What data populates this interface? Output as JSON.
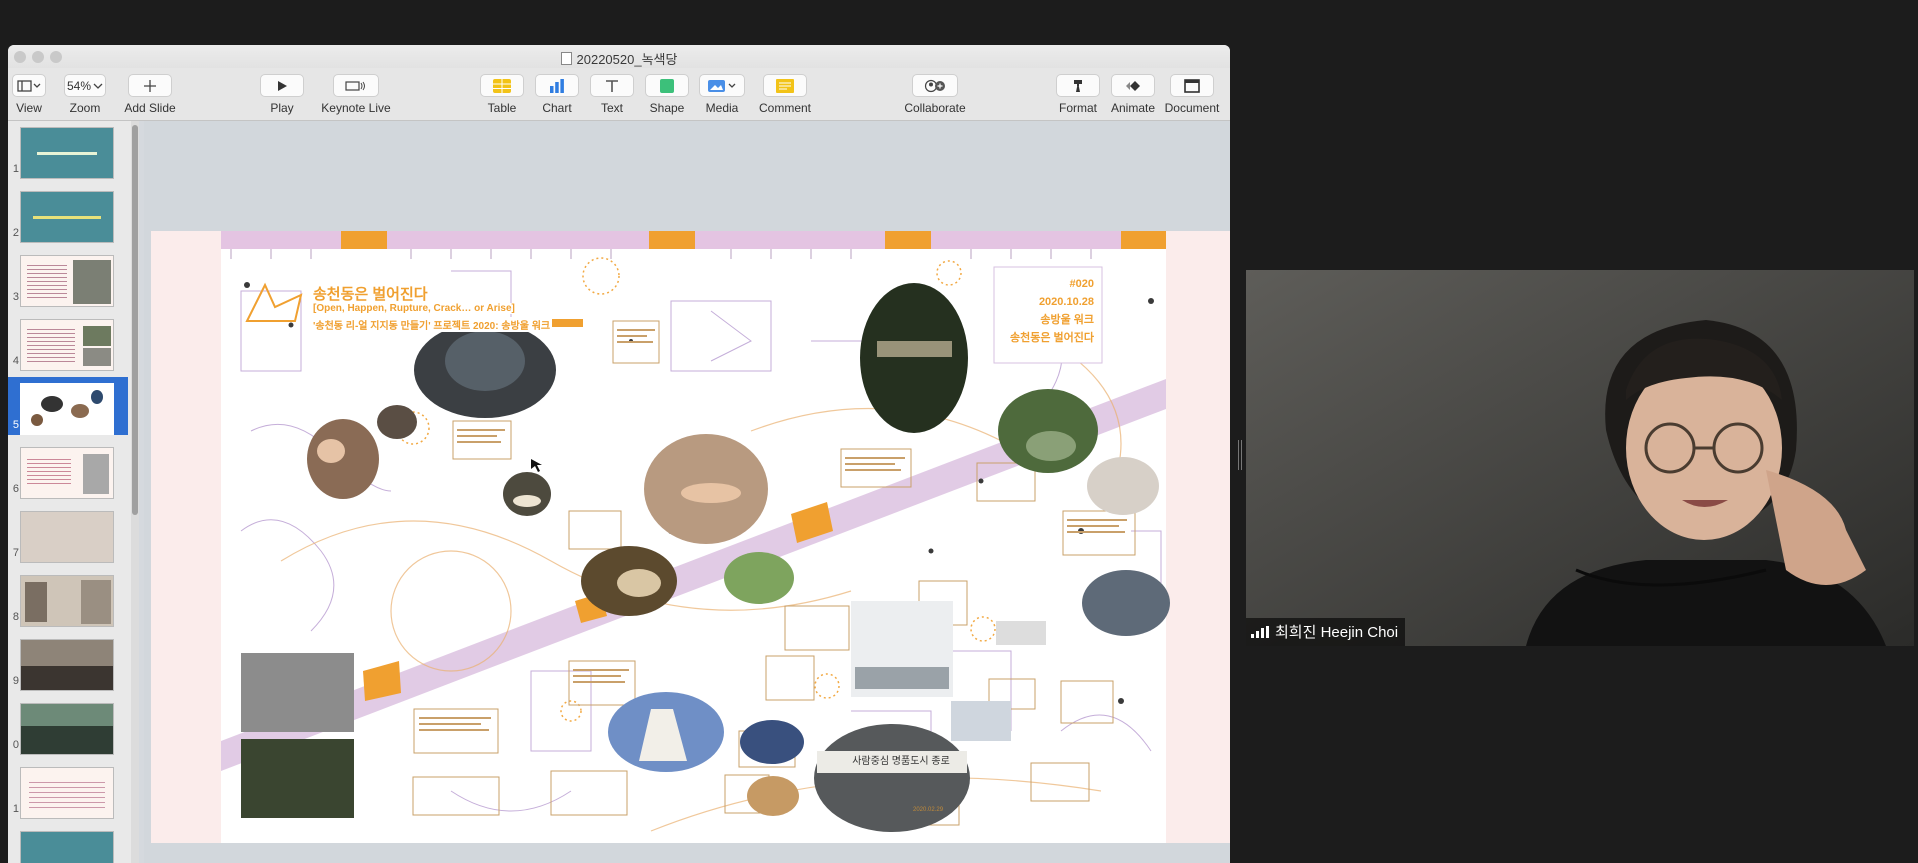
{
  "window": {
    "title": "20220520_녹색당"
  },
  "toolbar": {
    "view": "View",
    "zoom_value": "54%",
    "zoom": "Zoom",
    "add_slide": "Add Slide",
    "play": "Play",
    "keynote_live": "Keynote Live",
    "table": "Table",
    "chart": "Chart",
    "text": "Text",
    "shape": "Shape",
    "media": "Media",
    "comment": "Comment",
    "collaborate": "Collaborate",
    "format": "Format",
    "animate": "Animate",
    "document": "Document"
  },
  "navigator": {
    "slides": [
      {
        "number": "1",
        "selected": false
      },
      {
        "number": "2",
        "selected": false
      },
      {
        "number": "3",
        "selected": false
      },
      {
        "number": "4",
        "selected": false
      },
      {
        "number": "5",
        "selected": true
      },
      {
        "number": "6",
        "selected": false
      },
      {
        "number": "7",
        "selected": false
      },
      {
        "number": "8",
        "selected": false
      },
      {
        "number": "9",
        "selected": false
      },
      {
        "number": "0",
        "selected": false
      },
      {
        "number": "1",
        "selected": false
      }
    ]
  },
  "slide": {
    "title": "송천동은 벌어진다",
    "subtitle": "[Open, Happen, Rupture, Crack… or Arise]",
    "project": "'송천동 리-얼 지지동 만들기' 프로젝트 2020: 송방울 워크",
    "badge": {
      "number": "#020",
      "date": "2020.10.28",
      "line1": "송방울 워크",
      "line2": "송천동은 벌어진다"
    },
    "photo_sign": "사람중심 명품도시 종로",
    "small_date": "2020.02.29"
  },
  "participant": {
    "name": "최희진 Heejin Choi"
  }
}
